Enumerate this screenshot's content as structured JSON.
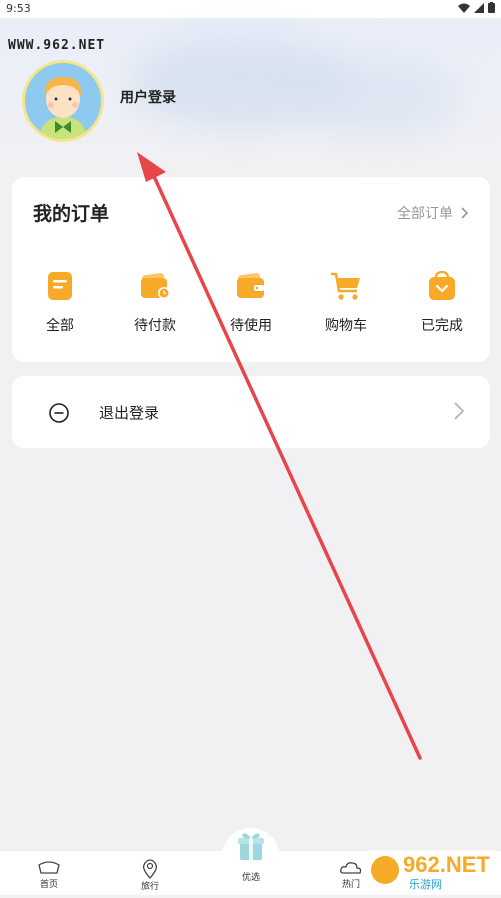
{
  "status_bar": {
    "time": "9:53"
  },
  "header": {
    "watermark": "WWW.962.NET",
    "login_label": "用户登录"
  },
  "orders": {
    "title": "我的订单",
    "all_orders_label": "全部订单",
    "items": [
      {
        "label": "全部",
        "icon": "clipboard-icon"
      },
      {
        "label": "待付款",
        "icon": "wallet-clock-icon"
      },
      {
        "label": "待使用",
        "icon": "wallet-icon"
      },
      {
        "label": "购物车",
        "icon": "cart-icon"
      },
      {
        "label": "已完成",
        "icon": "bag-check-icon"
      }
    ]
  },
  "logout": {
    "label": "退出登录"
  },
  "bottom_nav": {
    "items": [
      {
        "label": "首页"
      },
      {
        "label": "旅行"
      },
      {
        "label": "优选"
      },
      {
        "label": "热门"
      }
    ]
  },
  "watermark_bottom": {
    "brand": "962.NET",
    "sub": "乐游网"
  },
  "colors": {
    "accent_orange": "#f7a928",
    "annotation_red": "#e8454a",
    "card_bg": "#ffffff",
    "page_bg": "#f1f1f3"
  }
}
